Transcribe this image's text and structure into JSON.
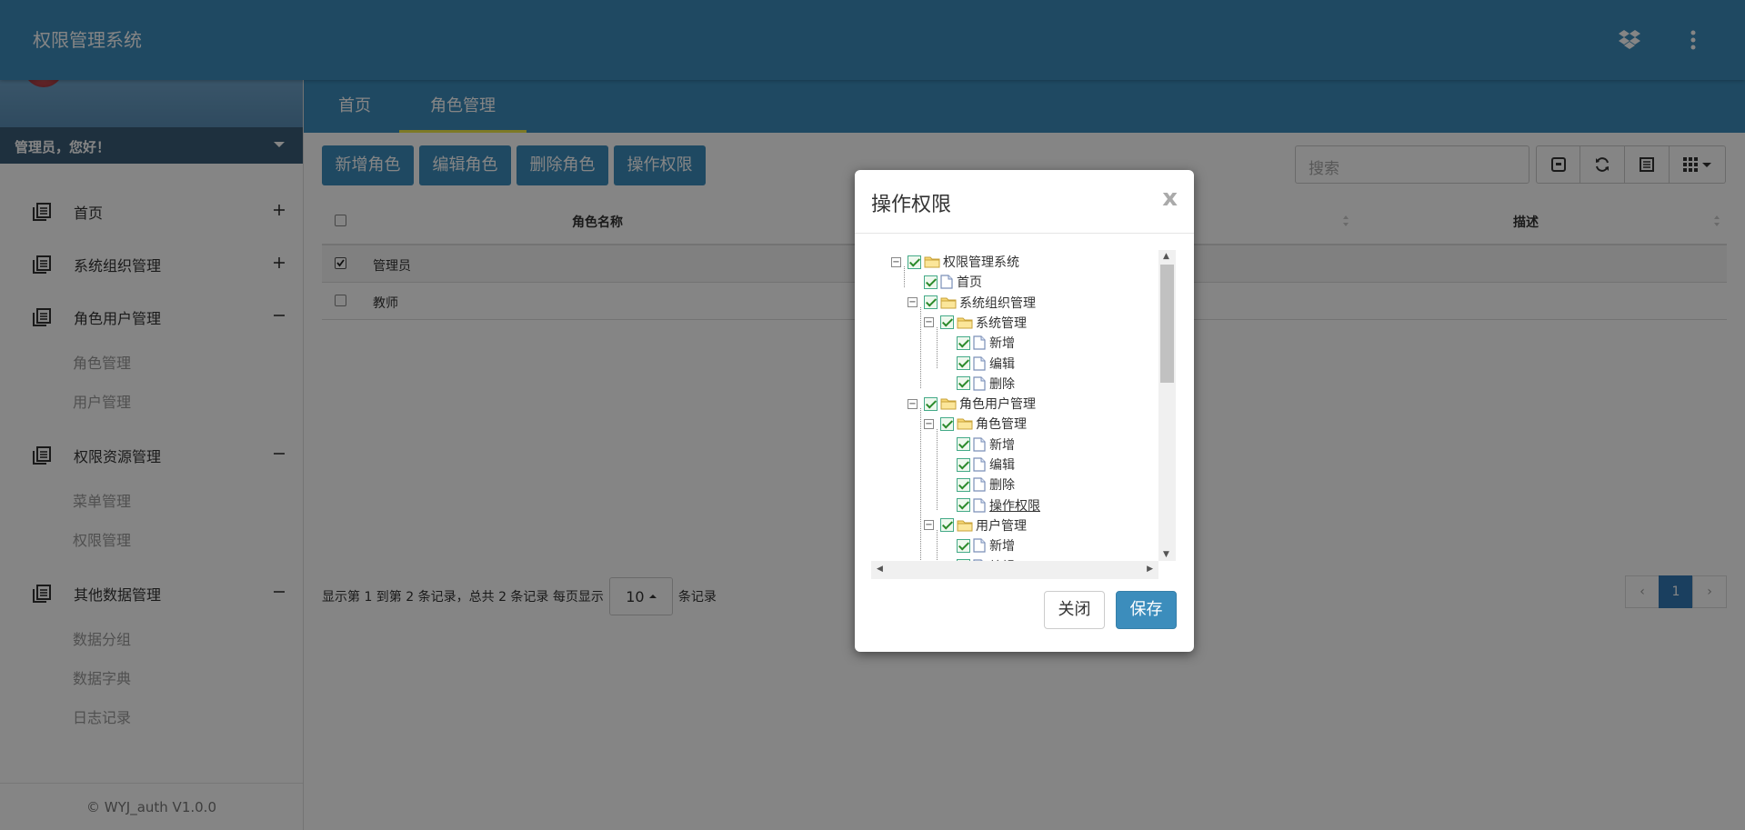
{
  "header": {
    "title": "权限管理系统",
    "icons": [
      "dropbox-icon",
      "more-vertical-icon"
    ]
  },
  "user": {
    "greeting": "管理员，您好！"
  },
  "sidebar": {
    "items": [
      {
        "label": "首页",
        "toggle": "+",
        "children": []
      },
      {
        "label": "系统组织管理",
        "toggle": "+",
        "children": []
      },
      {
        "label": "角色用户管理",
        "toggle": "−",
        "children": [
          "角色管理",
          "用户管理"
        ]
      },
      {
        "label": "权限资源管理",
        "toggle": "−",
        "children": [
          "菜单管理",
          "权限管理"
        ]
      },
      {
        "label": "其他数据管理",
        "toggle": "−",
        "children": [
          "数据分组",
          "数据字典",
          "日志记录"
        ]
      }
    ],
    "footer": "© WYJ_auth V1.0.0"
  },
  "tabs": [
    {
      "label": "首页"
    },
    {
      "label": "角色管理",
      "active": true
    }
  ],
  "toolbar": {
    "buttons": [
      "新增角色",
      "编辑角色",
      "删除角色",
      "操作权限"
    ],
    "search_placeholder": "搜索"
  },
  "table": {
    "columns": [
      "角色名称",
      "描述"
    ],
    "rows": [
      {
        "name": "管理员",
        "checked": true
      },
      {
        "name": "教师",
        "checked": false
      }
    ]
  },
  "pager": {
    "info_prefix": "显示第 1 到第 2 条记录，总共 2 条记录  每页显示",
    "page_size": "10",
    "info_suffix": "条记录",
    "prev": "‹",
    "current": "1",
    "next": "›"
  },
  "modal": {
    "title": "操作权限",
    "close_x": "x",
    "close_label": "关闭",
    "save_label": "保存",
    "tree": [
      {
        "label": "权限管理系统",
        "type": "folder",
        "level": 0,
        "switch": "−"
      },
      {
        "label": "首页",
        "type": "file",
        "level": 1
      },
      {
        "label": "系统组织管理",
        "type": "folder",
        "level": 1,
        "switch": "−"
      },
      {
        "label": "系统管理",
        "type": "folder",
        "level": 2,
        "switch": "−"
      },
      {
        "label": "新增",
        "type": "file",
        "level": 3
      },
      {
        "label": "编辑",
        "type": "file",
        "level": 3
      },
      {
        "label": "删除",
        "type": "file",
        "level": 3
      },
      {
        "label": "角色用户管理",
        "type": "folder",
        "level": 1,
        "switch": "−"
      },
      {
        "label": "角色管理",
        "type": "folder",
        "level": 2,
        "switch": "−"
      },
      {
        "label": "新增",
        "type": "file",
        "level": 3
      },
      {
        "label": "编辑",
        "type": "file",
        "level": 3
      },
      {
        "label": "删除",
        "type": "file",
        "level": 3
      },
      {
        "label": "操作权限",
        "type": "file",
        "level": 3,
        "hover": true
      },
      {
        "label": "用户管理",
        "type": "folder",
        "level": 2,
        "switch": "−"
      },
      {
        "label": "新增",
        "type": "file",
        "level": 3
      },
      {
        "label": "编辑",
        "type": "file",
        "level": 3
      }
    ]
  }
}
